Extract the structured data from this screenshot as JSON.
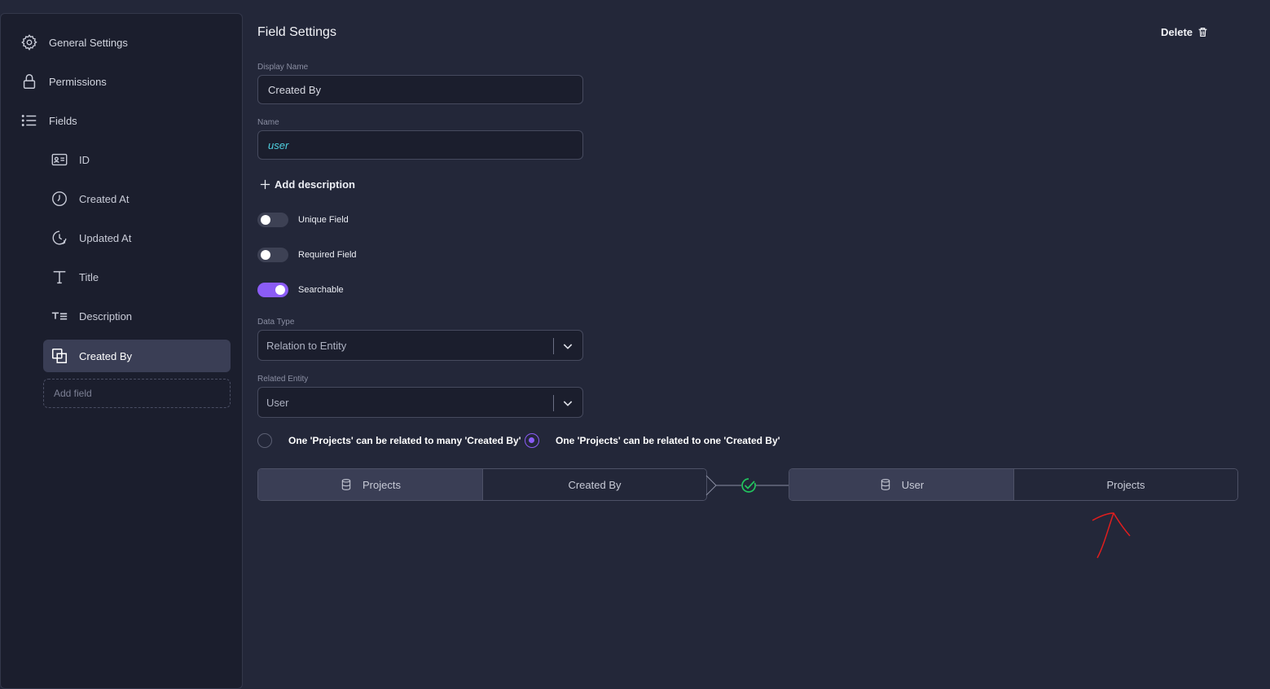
{
  "sidebar": {
    "nav": [
      {
        "label": "General Settings",
        "icon": "gear-icon"
      },
      {
        "label": "Permissions",
        "icon": "lock-icon"
      },
      {
        "label": "Fields",
        "icon": "list-icon"
      }
    ],
    "fields": [
      {
        "label": "ID",
        "icon": "id-card-icon"
      },
      {
        "label": "Created At",
        "icon": "clock-icon"
      },
      {
        "label": "Updated At",
        "icon": "clock-refresh-icon"
      },
      {
        "label": "Title",
        "icon": "text-icon"
      },
      {
        "label": "Description",
        "icon": "text-lines-icon"
      },
      {
        "label": "Created By",
        "icon": "relation-icon",
        "active": true
      }
    ],
    "add_field_placeholder": "Add field"
  },
  "main": {
    "title": "Field Settings",
    "delete_label": "Delete",
    "display_name": {
      "label": "Display Name",
      "value": "Created By"
    },
    "name": {
      "label": "Name",
      "value": "user"
    },
    "add_description": "Add description",
    "toggles": [
      {
        "label": "Unique Field",
        "on": false
      },
      {
        "label": "Required Field",
        "on": false
      },
      {
        "label": "Searchable",
        "on": true
      }
    ],
    "data_type": {
      "label": "Data Type",
      "value": "Relation to Entity"
    },
    "related_entity": {
      "label": "Related Entity",
      "value": "User"
    },
    "relation_options": [
      {
        "label": "One 'Projects' can be related to many 'Created By'",
        "selected": false
      },
      {
        "label": "One 'Projects' can be related to one 'Created By'",
        "selected": true
      }
    ],
    "diagram": {
      "left": {
        "entity": "Projects",
        "field": "Created By"
      },
      "right": {
        "entity": "User",
        "field": "Projects"
      }
    }
  },
  "colors": {
    "accent": "#8b5cf6",
    "success": "#22c55e",
    "annotation": "#e01e1e"
  }
}
